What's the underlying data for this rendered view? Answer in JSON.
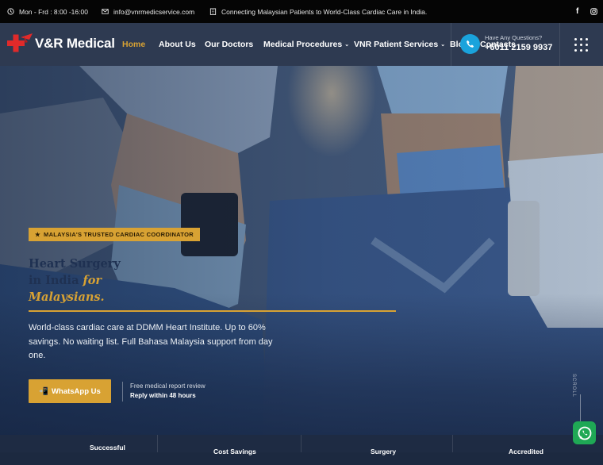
{
  "topbar": {
    "hours": "Mon - Frd : 8:00 -16:00",
    "email": "info@vnrmedicservice.com",
    "tagline": "Connecting Malaysian Patients to World-Class Cardiac Care in India.",
    "social": {
      "facebook": "f",
      "instagram": "◎"
    }
  },
  "header": {
    "logo_text": "V&R Medical",
    "nav": [
      {
        "label": "Home",
        "active": true
      },
      {
        "label": "About Us"
      },
      {
        "label": "Our Doctors"
      },
      {
        "label": "Medical Procedures",
        "dropdown": true
      },
      {
        "label": "VNR Patient Services",
        "dropdown": true
      },
      {
        "label": "Blog"
      },
      {
        "label": "Contacts"
      }
    ],
    "question_label": "Have Any Questions?",
    "phone": "+6011 2159 9937",
    "chevron": "⌄"
  },
  "hero": {
    "badge": "MALAYSIA'S TRUSTED CARDIAC COORDINATOR",
    "badge_star": "★",
    "headline_line1": "Heart Surgery",
    "headline_line2_plain": "in India ",
    "headline_line2_accent": "for",
    "headline_line3_accent": "Malaysians.",
    "subtext": "World-class cardiac care at DDMM Heart Institute. Up to 60% savings. No waiting list. Full Bahasa Malaysia support from day one.",
    "cta_label": "WhatsApp Us",
    "cta_icon": "📲",
    "note_line1": "Free medical report review",
    "note_line2": "Reply within 48 hours",
    "scroll_label": "SCROLL"
  },
  "stats": [
    "Successful",
    "Cost Savings",
    "Surgery",
    "Accredited"
  ],
  "colors": {
    "accent": "#d8a233",
    "header_bg": "#2e3a51",
    "topbar_bg": "#050505",
    "call_blue": "#1aa3dc",
    "whatsapp_green": "#1fa855"
  },
  "icons": {
    "clock": "clock-icon",
    "mail": "mail-icon",
    "building": "building-icon",
    "facebook": "facebook-icon",
    "instagram": "instagram-icon",
    "phone": "phone-icon",
    "menu_grid": "grid-menu-icon",
    "whatsapp": "whatsapp-icon"
  }
}
